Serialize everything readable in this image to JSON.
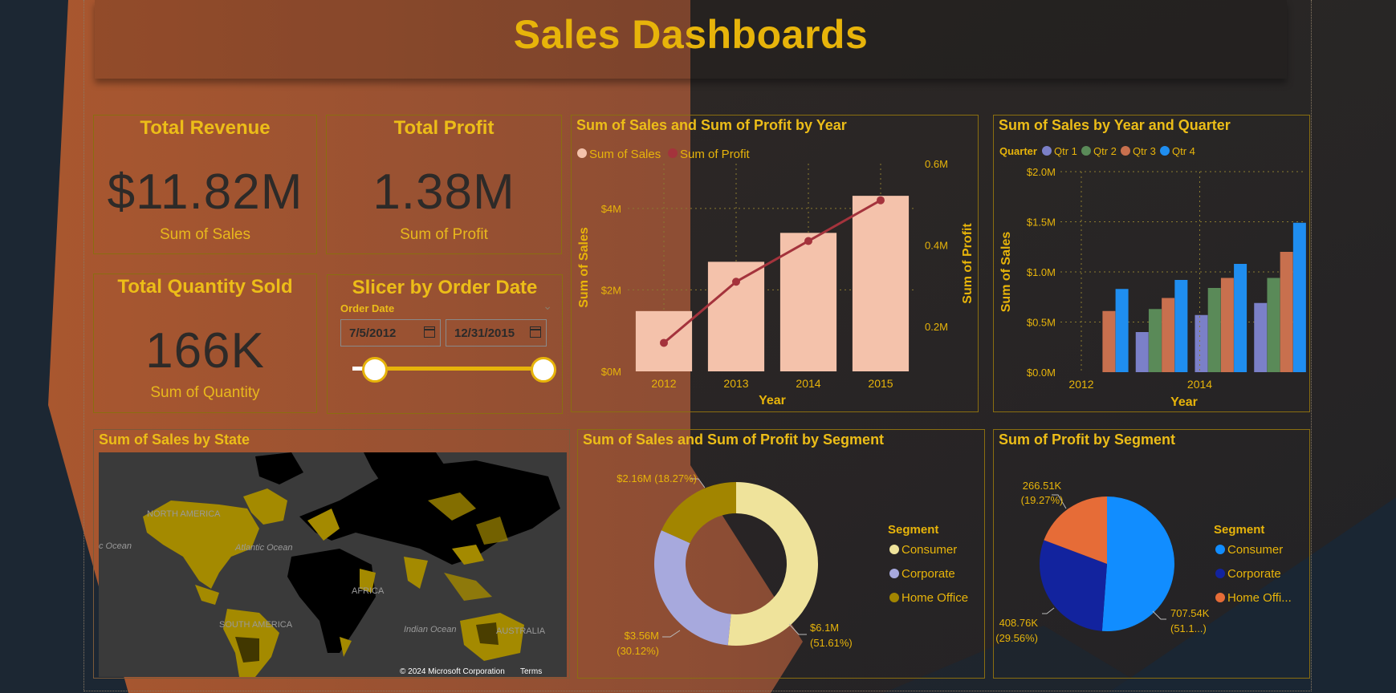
{
  "dashboard": {
    "title": "Sales Dashboards"
  },
  "kpis": {
    "revenue": {
      "title": "Total Revenue",
      "value": "$11.82M",
      "sub": "Sum of Sales"
    },
    "profit": {
      "title": "Total Profit",
      "value": "1.38M",
      "sub": "Sum of Profit"
    },
    "quantity": {
      "title": "Total Quantity Sold",
      "value": "166K",
      "sub": "Sum of Quantity"
    }
  },
  "slicer": {
    "title": "Slicer by Order Date",
    "label": "Order Date",
    "start": "7/5/2012",
    "end": "12/31/2015",
    "chevron": "chevron-down-icon",
    "range": [
      0.0,
      1.0
    ]
  },
  "map": {
    "title": "Sum of Sales by State",
    "labels": [
      "NORTH AMERICA",
      "Atlantic Ocean",
      "c Ocean",
      "AFRICA",
      "SOUTH AMERICA",
      "Indian Ocean",
      "AUSTRALIA"
    ],
    "copyright": "© 2024 Microsoft Corporation",
    "terms": "Terms"
  },
  "colors": {
    "accent": "#e7b40a",
    "sales_bar": "#f4c2ab",
    "profit_line": "#a4333c",
    "qtr1": "#7b80c8",
    "qtr2": "#5a8a58",
    "qtr3": "#c8704e",
    "qtr4": "#1f8ef0",
    "seg_consumer_donut": "#efe39b",
    "seg_corporate_donut": "#a7a9dd",
    "seg_home_donut": "#a28500",
    "seg_consumer_pie": "#118dff",
    "seg_corporate_pie": "#12239e",
    "seg_home_pie": "#e66c37"
  },
  "chart_data": [
    {
      "id": "sales_profit_year",
      "type": "bar",
      "title": "Sum of Sales and Sum of Profit by Year",
      "xlabel": "Year",
      "ylabel": "Sum of Sales",
      "y2label": "Sum of Profit",
      "categories": [
        "2012",
        "2013",
        "2014",
        "2015"
      ],
      "series": [
        {
          "name": "Sum of Sales",
          "kind": "bar",
          "axis": "left",
          "values": [
            1.48,
            2.69,
            3.4,
            4.31
          ]
        },
        {
          "name": "Sum of Profit",
          "kind": "line",
          "axis": "right",
          "values": [
            0.16,
            0.31,
            0.41,
            0.51
          ]
        }
      ],
      "ylim": [
        0,
        5.1
      ],
      "y2lim": [
        0.09,
        0.6
      ],
      "yticks": [
        "$0M",
        "$2M",
        "$4M"
      ],
      "y2ticks": [
        "0.2M",
        "0.4M",
        "0.6M"
      ],
      "legend": "top-left",
      "grid": true
    },
    {
      "id": "sales_year_quarter",
      "type": "bar",
      "title": "Sum of Sales by Year and Quarter",
      "legend_title": "Quarter",
      "xlabel": "Year",
      "ylabel": "Sum of Sales",
      "categories": [
        "2012",
        "2013",
        "2014",
        "2015"
      ],
      "x_ticks": [
        "2012",
        "2014"
      ],
      "series": [
        {
          "name": "Qtr 1",
          "values": [
            null,
            0.4,
            0.57,
            0.69
          ]
        },
        {
          "name": "Qtr 2",
          "values": [
            null,
            0.63,
            0.84,
            0.94
          ]
        },
        {
          "name": "Qtr 3",
          "values": [
            0.61,
            0.74,
            0.94,
            1.2
          ]
        },
        {
          "name": "Qtr 4",
          "values": [
            0.83,
            0.92,
            1.08,
            1.49
          ]
        }
      ],
      "ylim": [
        0,
        2.0
      ],
      "yticks": [
        "$0.0M",
        "$0.5M",
        "$1.0M",
        "$1.5M",
        "$2.0M"
      ],
      "legend": "top-left",
      "grid": true
    },
    {
      "id": "sales_profit_segment",
      "type": "pie",
      "donut": true,
      "title": "Sum of Sales and Sum of Profit by Segment",
      "legend_title": "Segment",
      "categories": [
        "Consumer",
        "Corporate",
        "Home Office"
      ],
      "values": [
        6.1,
        3.56,
        2.16
      ],
      "percents": [
        51.61,
        30.12,
        18.27
      ],
      "data_labels": [
        [
          "$6.1M",
          "(51.61%)"
        ],
        [
          "$3.56M",
          "(30.12%)"
        ],
        [
          "$2.16M (18.27%)"
        ]
      ],
      "legend": "right"
    },
    {
      "id": "profit_segment",
      "type": "pie",
      "title": "Sum of Profit by Segment",
      "legend_title": "Segment",
      "categories": [
        "Consumer",
        "Corporate",
        "Home Office"
      ],
      "legend_labels": [
        "Consumer",
        "Corporate",
        "Home Offi..."
      ],
      "values": [
        707.54,
        408.76,
        266.51
      ],
      "percents": [
        51.16,
        29.56,
        19.27
      ],
      "data_labels": [
        [
          "707.54K",
          "(51.1...)"
        ],
        [
          "408.76K",
          "(29.56%)"
        ],
        [
          "266.51K",
          "(19.27%)"
        ]
      ],
      "legend": "right"
    }
  ]
}
